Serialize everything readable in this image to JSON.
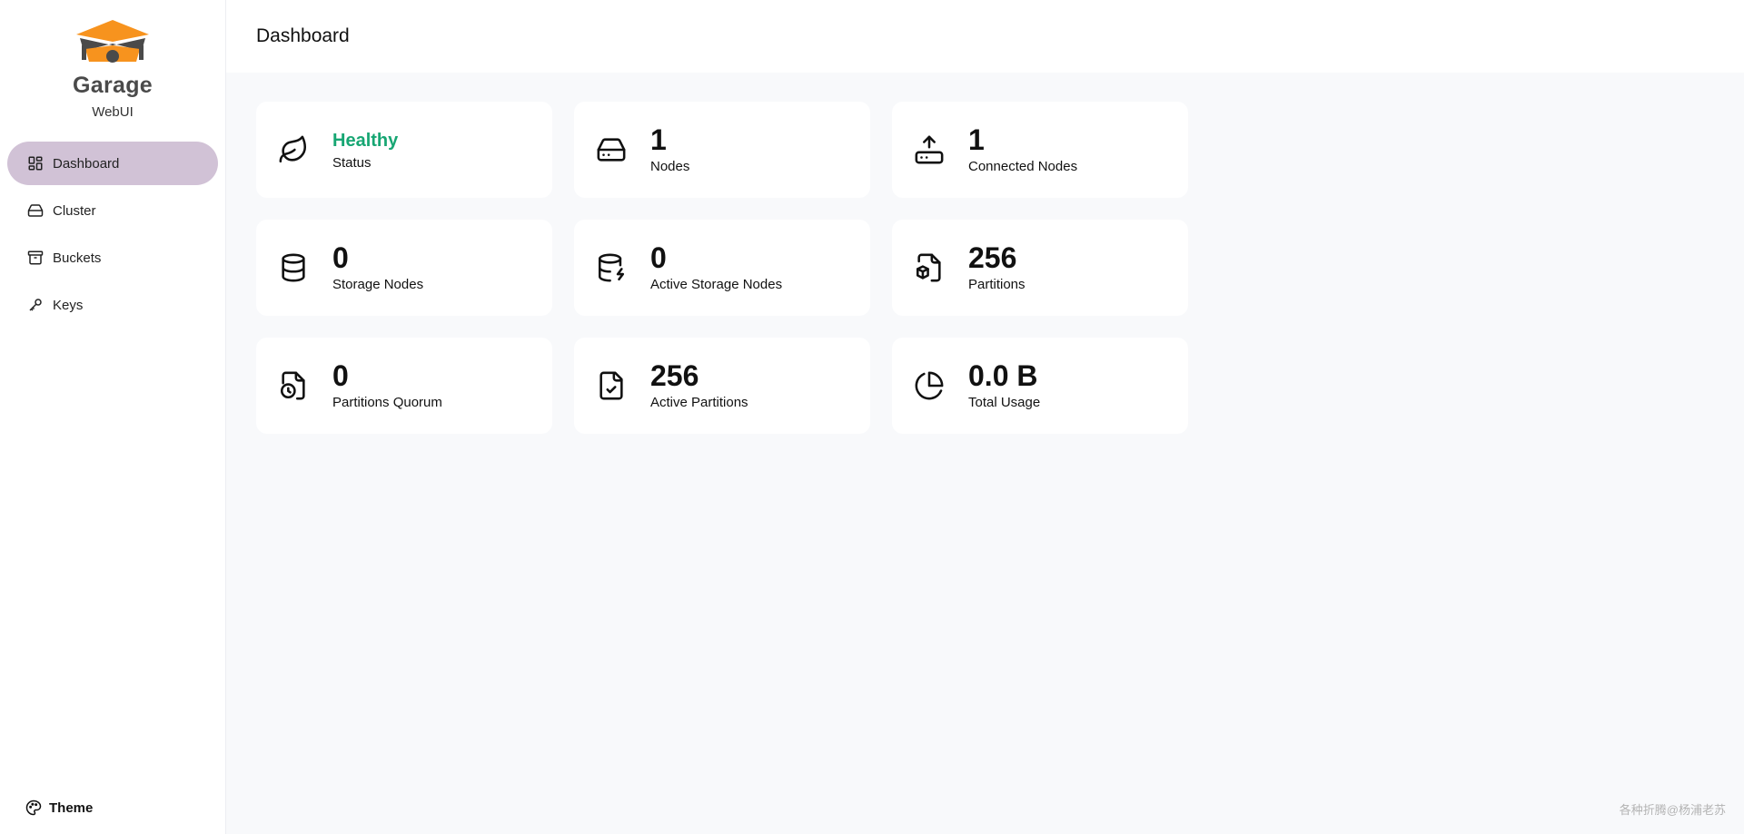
{
  "brand": {
    "name": "Garage",
    "subtitle": "WebUI"
  },
  "sidebar": {
    "items": [
      {
        "label": "Dashboard",
        "icon": "dashboard-icon",
        "active": true
      },
      {
        "label": "Cluster",
        "icon": "hard-drive-icon",
        "active": false
      },
      {
        "label": "Buckets",
        "icon": "archive-icon",
        "active": false
      },
      {
        "label": "Keys",
        "icon": "key-icon",
        "active": false
      }
    ],
    "theme_label": "Theme"
  },
  "header": {
    "title": "Dashboard"
  },
  "cards": [
    {
      "value": "Healthy",
      "label": "Status",
      "icon": "leaf-icon"
    },
    {
      "value": "1",
      "label": "Nodes",
      "icon": "hard-drive-icon"
    },
    {
      "value": "1",
      "label": "Connected Nodes",
      "icon": "upload-drive-icon"
    },
    {
      "value": "0",
      "label": "Storage Nodes",
      "icon": "database-icon"
    },
    {
      "value": "0",
      "label": "Active Storage Nodes",
      "icon": "database-bolt-icon"
    },
    {
      "value": "256",
      "label": "Partitions",
      "icon": "file-box-icon"
    },
    {
      "value": "0",
      "label": "Partitions Quorum",
      "icon": "file-clock-icon"
    },
    {
      "value": "256",
      "label": "Active Partitions",
      "icon": "file-check-icon"
    },
    {
      "value": "0.0 B",
      "label": "Total Usage",
      "icon": "pie-chart-icon"
    }
  ],
  "colors": {
    "accent": "#d1c2d6",
    "healthy": "#17a673",
    "logo_orange": "#f7931e",
    "logo_dark": "#4a4a4a"
  },
  "watermark": "各种折腾@杨浦老苏"
}
